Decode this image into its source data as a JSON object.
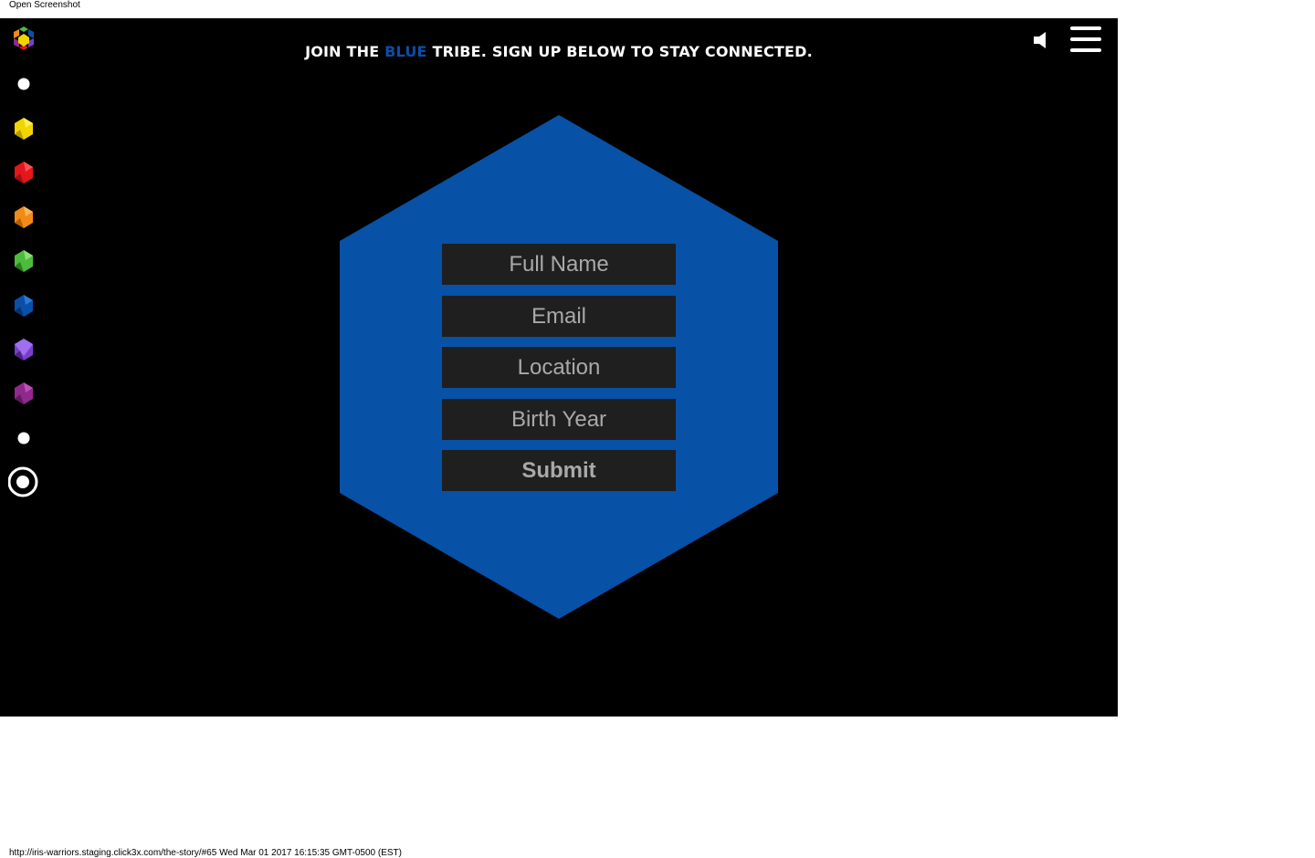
{
  "top_label": "Open Screenshot",
  "header": {
    "headline_prefix": "JOIN THE ",
    "headline_accent": "BLUE",
    "headline_suffix": " TRIBE. SIGN UP BELOW TO STAY CONNECTED.",
    "accent_color": "#0a4fa8"
  },
  "controls": {
    "sound_icon": "speaker-icon",
    "menu_icon": "hamburger-menu-icon"
  },
  "side_nav": {
    "items": [
      {
        "icon": "multicolor-logo-icon"
      },
      {
        "icon": "white-dot-icon"
      },
      {
        "icon": "yellow-gem-icon",
        "color": "#f2d500"
      },
      {
        "icon": "red-gem-icon",
        "color": "#e3171b"
      },
      {
        "icon": "orange-gem-icon",
        "color": "#f28a18"
      },
      {
        "icon": "green-gem-icon",
        "color": "#4dbb3c"
      },
      {
        "icon": "blue-gem-icon",
        "color": "#0a4fa8"
      },
      {
        "icon": "violet-gem-icon",
        "color": "#7a3fc9"
      },
      {
        "icon": "purple-gem-icon",
        "color": "#8f2a8c"
      },
      {
        "icon": "white-dot-icon"
      },
      {
        "icon": "target-ring-icon"
      }
    ]
  },
  "hexagon": {
    "color": "#0751a6"
  },
  "form": {
    "full_name_placeholder": "Full Name",
    "email_placeholder": "Email",
    "location_placeholder": "Location",
    "birth_year_placeholder": "Birth Year",
    "submit_label": "Submit"
  },
  "status_line": "http://iris-warriors.staging.click3x.com/the-story/#65 Wed Mar 01 2017 16:15:35 GMT-0500 (EST)"
}
